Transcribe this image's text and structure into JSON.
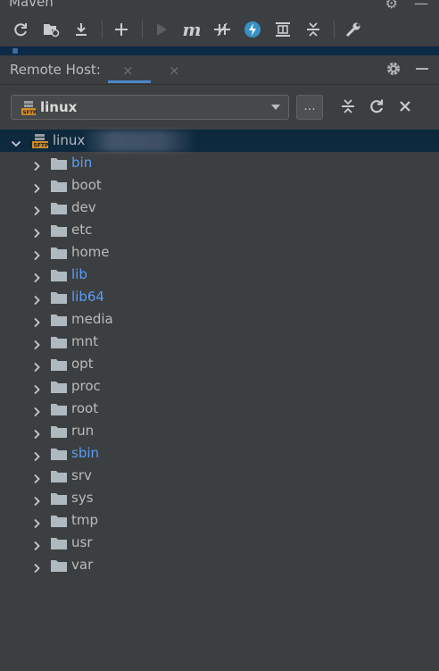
{
  "maven": {
    "title": "Maven"
  },
  "maven_toolbar": {
    "icons": [
      "refresh-icon",
      "reimport-folder-icon",
      "download-icon",
      "add-icon",
      "run-icon",
      "maven-goal-icon",
      "toggle-offline-icon",
      "skip-tests-icon",
      "show-dependencies-icon",
      "collapse-all-icon",
      "settings-wrench-icon"
    ]
  },
  "remote_host": {
    "title": "Remote Host:",
    "tab_close_1": "×",
    "tab_close_2": "×",
    "host_selected": "linux",
    "browse_label": "...",
    "root_name": "linux",
    "folders": [
      {
        "name": "bin",
        "link": true
      },
      {
        "name": "boot",
        "link": false
      },
      {
        "name": "dev",
        "link": false
      },
      {
        "name": "etc",
        "link": false
      },
      {
        "name": "home",
        "link": false
      },
      {
        "name": "lib",
        "link": true
      },
      {
        "name": "lib64",
        "link": true
      },
      {
        "name": "media",
        "link": false
      },
      {
        "name": "mnt",
        "link": false
      },
      {
        "name": "opt",
        "link": false
      },
      {
        "name": "proc",
        "link": false
      },
      {
        "name": "root",
        "link": false
      },
      {
        "name": "run",
        "link": false
      },
      {
        "name": "sbin",
        "link": true
      },
      {
        "name": "srv",
        "link": false
      },
      {
        "name": "sys",
        "link": false
      },
      {
        "name": "tmp",
        "link": false
      },
      {
        "name": "usr",
        "link": false
      },
      {
        "name": "var",
        "link": false
      }
    ]
  },
  "colors": {
    "panel_bg": "#3c3f41",
    "selection_bg": "#0d293e",
    "link_text": "#589df6",
    "text": "#bbbbbb",
    "folder": "#aeb9c0"
  }
}
